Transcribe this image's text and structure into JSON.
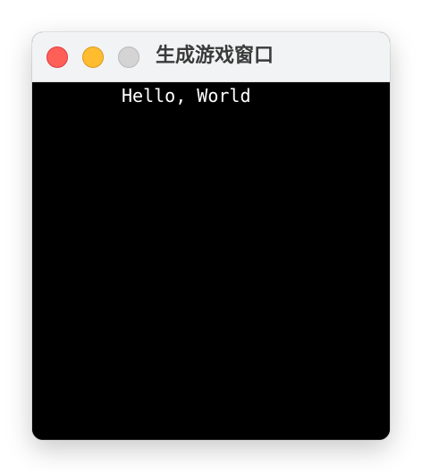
{
  "window": {
    "title": "生成游戏窗口",
    "controls": {
      "close": {
        "icon": "close-icon",
        "color": "#fe5f57"
      },
      "minimize": {
        "icon": "minimize-icon",
        "color": "#febc2e"
      },
      "zoom": {
        "icon": "zoom-icon",
        "color": "#d4d4d4"
      }
    },
    "titlebar_color": "#f2f3f4"
  },
  "game": {
    "background": "#000000",
    "text": "Hello, World",
    "text_color": "#ffffff"
  }
}
